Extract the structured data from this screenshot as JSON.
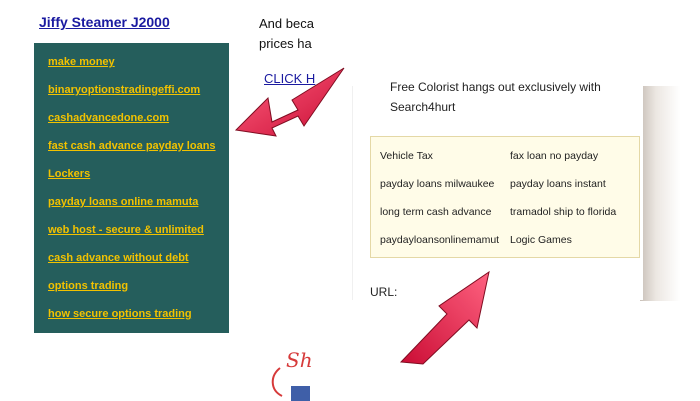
{
  "header": {
    "title_link": "Jiffy Steamer J2000"
  },
  "sidebar_links": [
    "make money",
    "binaryoptionstradingeffi.com",
    "cashadvancedone.com",
    "fast cash advance payday loans",
    "Lockers",
    "payday loans online mamuta",
    "web host - secure & unlimited",
    "cash advance without debt",
    "options trading",
    "how secure options trading"
  ],
  "background_text": {
    "line1": "And beca",
    "line2": "prices ha",
    "click_link": "CLICK H"
  },
  "panel": {
    "caption_line1": "Free Colorist hangs out exclusively with",
    "caption_line2": "Search4hurt",
    "ad_links": [
      [
        "Vehicle Tax",
        "fax loan no payday"
      ],
      [
        "payday loans milwaukee",
        "payday loans instant"
      ],
      [
        "long term cash advance",
        "tramadol ship to florida"
      ],
      [
        "paydayloansonlinemamut",
        "Logic Games"
      ]
    ],
    "url_label": "URL:"
  },
  "footer": {
    "show_text": "Sh"
  },
  "colors": {
    "teal": "#255e5c",
    "link_yellow": "#f2c200",
    "arrow_red": "#e8103a",
    "ad_bg": "#fffce8"
  }
}
